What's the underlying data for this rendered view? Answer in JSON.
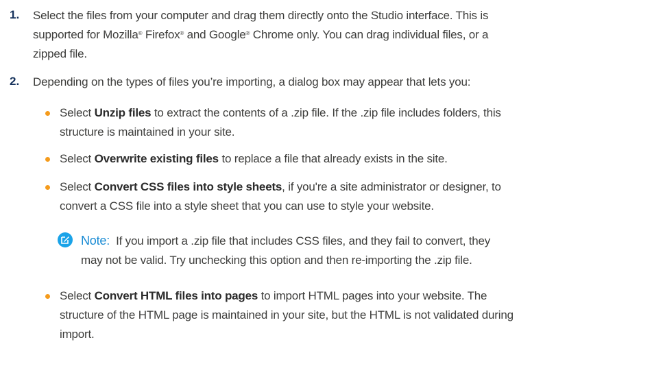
{
  "steps": [
    {
      "num": "1.",
      "t1": "Select the files from your computer and drag them directly onto the Studio interface. This is",
      "t2a": "supported for Mozilla",
      "reg": "®",
      "t2b": " Firefox",
      "t2c": " and Google",
      "t2d": " Chrome only. You can drag individual files, or a",
      "t3": "zipped file."
    },
    {
      "num": "2.",
      "text": "Depending on the types of files you’re importing, a dialog box may appear that lets you:"
    }
  ],
  "bullets": [
    {
      "pre": "Select ",
      "bold": "Unzip files",
      "post": " to extract the contents of a .zip file. If the .zip file includes folders, this",
      "line2": "structure is maintained in your site."
    },
    {
      "pre": "Select ",
      "bold": "Overwrite existing files",
      "post": " to replace a file that already exists in the site."
    },
    {
      "pre": "Select ",
      "bold": "Convert CSS files into style sheets",
      "post": ", if you're a site administrator or designer, to",
      "line2": "convert a CSS file into a style sheet that you can use to style your website."
    },
    {
      "pre": "Select ",
      "bold": "Convert HTML files into pages",
      "post": " to import HTML pages into your website. The",
      "line2": "structure of the HTML page is maintained in your site, but the HTML is not validated during",
      "line3": "import."
    }
  ],
  "note": {
    "icon": "note-edit-icon",
    "label": "Note:",
    "line1": "If you import a .zip file that includes CSS files, and they fail to convert, they",
    "line2": "may not be valid. Try unchecking this option and then re-importing the .zip file."
  },
  "colors": {
    "step_number": "#16325c",
    "bullet": "#f59b1c",
    "note_icon": "#1aa3e8",
    "note_label": "#1589d3"
  }
}
